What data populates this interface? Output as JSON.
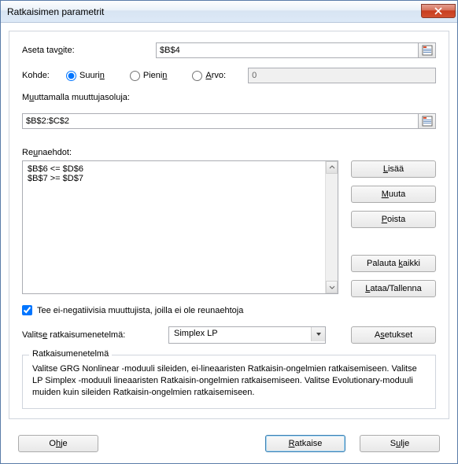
{
  "window": {
    "title": "Ratkaisimen parametrit"
  },
  "objective": {
    "label": "Aseta tavoite:",
    "value": "$B$4"
  },
  "target": {
    "label": "Kohde:",
    "options": {
      "max": "Suurin",
      "min": "Pienin",
      "value": "Arvo:"
    },
    "value_input": "0",
    "selected": "max"
  },
  "changing": {
    "label": "Muuttamalla muuttujasoluja:",
    "value": "$B$2:$C$2"
  },
  "constraints": {
    "label": "Reunaehdot:",
    "items": [
      "$B$6 <= $D$6",
      "$B$7 >= $D$7"
    ]
  },
  "buttons": {
    "add": "Lisää",
    "change": "Muuta",
    "delete": "Poista",
    "reset": "Palauta kaikki",
    "loadsave": "Lataa/Tallenna",
    "options": "Asetukset",
    "help": "Ohje",
    "solve": "Ratkaise",
    "close": "Sulje"
  },
  "nonneg": {
    "label": "Tee ei-negatiivisia muuttujista, joilla ei ole reunaehtoja",
    "checked": true
  },
  "method": {
    "label": "Valitse ratkaisumenetelmä:",
    "selected": "Simplex LP"
  },
  "description": {
    "title": "Ratkaisumenetelmä",
    "text": "Valitse GRG Nonlinear -moduuli sileiden, ei-lineaaristen Ratkaisin-ongelmien ratkaisemiseen. Valitse LP Simplex -moduuli lineaaristen Ratkaisin-ongelmien ratkaisemiseen. Valitse Evolutionary-moduuli muiden kuin sileiden Ratkaisin-ongelmien ratkaisemiseen."
  }
}
